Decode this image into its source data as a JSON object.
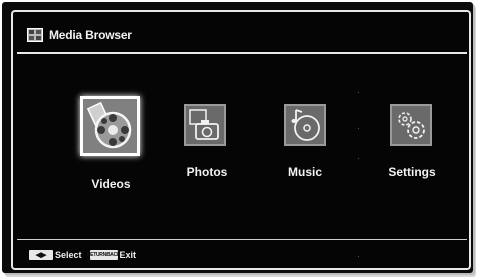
{
  "header": {
    "title": "Media Browser",
    "icon": "media-browser-icon"
  },
  "menu": {
    "items": [
      {
        "id": "videos",
        "label": "Videos",
        "icon": "film-reel-icon",
        "selected": true
      },
      {
        "id": "photos",
        "label": "Photos",
        "icon": "camera-photos-icon",
        "selected": false
      },
      {
        "id": "music",
        "label": "Music",
        "icon": "music-disc-icon",
        "selected": false
      },
      {
        "id": "settings",
        "label": "Settings",
        "icon": "gears-icon",
        "selected": false
      }
    ]
  },
  "footer": {
    "select_key": "◀▶",
    "select_label": "Select",
    "exit_key": "RETURN/BACK",
    "exit_label": "Exit"
  },
  "colors": {
    "background": "#050505",
    "text": "#f2f2f2",
    "tile": "#6a6a6a",
    "selected_border": "#ffffff"
  }
}
